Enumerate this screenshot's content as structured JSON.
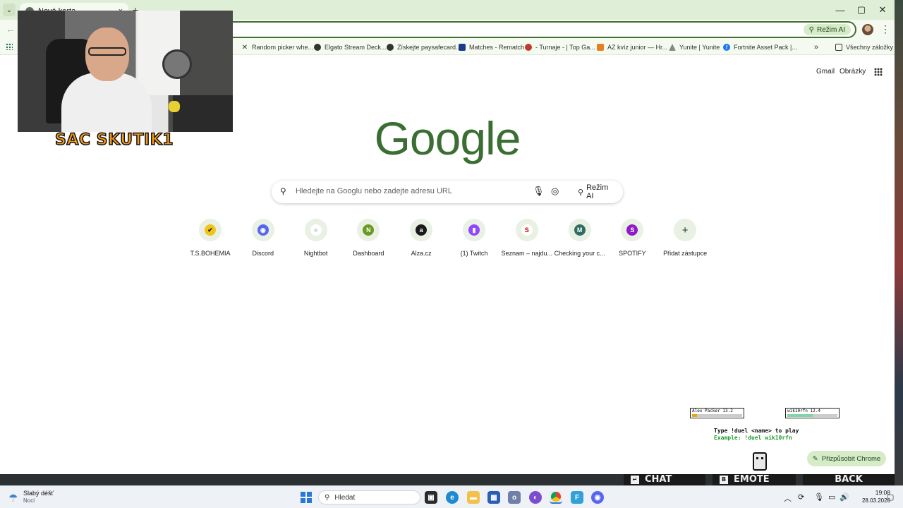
{
  "browser": {
    "tab_title": "Nová karta",
    "tab_close": "×",
    "new_tab": "+",
    "window_controls": [
      "—",
      "▢",
      "✕"
    ],
    "omnibox_ai_chip": "Režim AI",
    "apps_icon": "apps-icon"
  },
  "bookmarks": {
    "items": [
      {
        "label": "Random picker whe...",
        "icon": "tools-icon"
      },
      {
        "label": "Elgato Stream Deck...",
        "icon": "globe-icon"
      },
      {
        "label": "Získejte paysafecard...",
        "icon": "globe-icon"
      },
      {
        "label": "Matches - Rematch",
        "icon": "rematch-icon"
      },
      {
        "label": "- Turnaje - | Top Ga...",
        "icon": "cs-icon"
      },
      {
        "label": "AZ kvíz junior — Hr...",
        "icon": "az-icon"
      },
      {
        "label": "Yunite | Yunite",
        "icon": "yunite-icon"
      },
      {
        "label": "Fortnite Asset Pack |...",
        "icon": "facebook-icon"
      }
    ],
    "more": "»",
    "all_bookmarks": "Všechny záložky"
  },
  "page": {
    "gmail": "Gmail",
    "images": "Obrázky",
    "logo": "Google",
    "search_placeholder": "Hledejte na Googlu nebo zadejte adresu URL",
    "search_ai": "Režim AI",
    "shortcuts": [
      {
        "label": "T.S.BOHEMIA",
        "letter": "✔",
        "color": "#f2c318",
        "fg": "#1a1a1a"
      },
      {
        "label": "Discord",
        "letter": "◉",
        "color": "#5865f2",
        "fg": "#ffffff"
      },
      {
        "label": "Nightbot",
        "letter": "■",
        "color": "#ffffff",
        "fg": "#d8d8d8"
      },
      {
        "label": "Dashboard",
        "letter": "N",
        "color": "#6b9a23",
        "fg": "#ffffff"
      },
      {
        "label": "Alza.cz",
        "letter": "a",
        "color": "#1a1a1a",
        "fg": "#ffffff"
      },
      {
        "label": "(1) Twitch",
        "letter": "▮",
        "color": "#9146ff",
        "fg": "#ffffff"
      },
      {
        "label": "Seznam – najdu...",
        "letter": "S",
        "color": "#ffffff",
        "fg": "#cc0000"
      },
      {
        "label": "Checking your c...",
        "letter": "M",
        "color": "#2f6d63",
        "fg": "#ffffff"
      },
      {
        "label": "SPOTIFY",
        "letter": "S",
        "color": "#8f1bc9",
        "fg": "#ffffff"
      },
      {
        "label": "Přidat zástupce",
        "letter": "+",
        "color": "transparent",
        "fg": "#333333"
      }
    ],
    "customize": "Přizpůsobit Chrome"
  },
  "overlay": {
    "webcam_name": "SAC SKUTIK1",
    "player1": {
      "name": "Alex Packer",
      "level": "13.2",
      "hp": 0.1,
      "hp_color": "#e8a317"
    },
    "player2": {
      "name": "wik10rfn",
      "level": "12.4",
      "hp": 0.5,
      "hp_color": "#7cd6a6"
    },
    "duel_line1": "Type !duel <name> to play",
    "duel_line2": "Example: !duel wik10rfn",
    "buttons": [
      {
        "key": "↵",
        "label": "CHAT"
      },
      {
        "key": "B",
        "label": "EMOTE"
      },
      {
        "key": "",
        "label": "BACK"
      }
    ]
  },
  "taskbar": {
    "weather_line1": "Slabý déšť",
    "weather_line2": "Noci",
    "search": "Hledat",
    "time": "19:08",
    "date": "28.03.2026"
  }
}
